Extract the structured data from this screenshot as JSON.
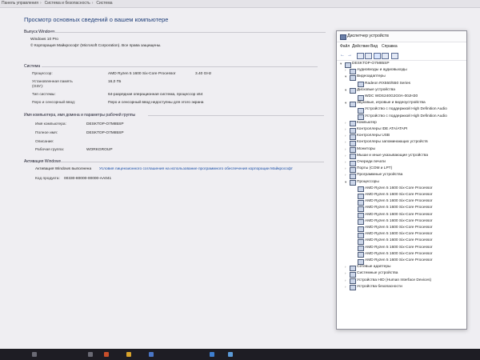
{
  "breadcrumb": {
    "items": [
      "Панель управления",
      "Система и безопасность",
      "Система"
    ]
  },
  "system": {
    "heading": "Просмотр основных сведений о вашем компьютере",
    "edition": {
      "section_title": "Выпуск Windows",
      "name": "Windows 10 Pro",
      "copyright": "© Корпорация Майкрософт (Microsoft Corporation). Все права защищены."
    },
    "specs": {
      "section_title": "Система",
      "rows": [
        {
          "label": "Процессор:",
          "value": "AMD Ryzen 5 1600 Six-Core Processor",
          "extra": "3.40 GHz"
        },
        {
          "label": "Установленная память (ОЗУ):",
          "value": "16,0 ГБ",
          "extra": ""
        },
        {
          "label": "Тип системы:",
          "value": "64-разрядная операционная система, процессор x64",
          "extra": ""
        },
        {
          "label": "Перо и сенсорный ввод:",
          "value": "Перо и сенсорный ввод недоступны для этого экрана",
          "extra": ""
        }
      ]
    },
    "computer": {
      "section_title": "Имя компьютера, имя домена и параметры рабочей группы",
      "rows": [
        {
          "label": "Имя компьютера:",
          "value": "DESKTOP-O7M85SP"
        },
        {
          "label": "Полное имя:",
          "value": "DESKTOP-O7M85SP"
        },
        {
          "label": "Описание:",
          "value": ""
        },
        {
          "label": "Рабочая группа:",
          "value": "WORKGROUP"
        }
      ]
    },
    "activation": {
      "section_title": "Активация Windows",
      "status": "Активация Windows выполнена",
      "link": "Условия лицензионного соглашения на использование программного обеспечения корпорации Майкрософт",
      "product_label": "Код продукта:",
      "product_id": "00330-80000-00000-AA041"
    }
  },
  "device_manager": {
    "title": "Диспетчер устройств",
    "menu": [
      "Файл",
      "Действие",
      "Вид",
      "Справка"
    ],
    "tree": [
      {
        "level": 0,
        "expanded": true,
        "label": "DESKTOP-O7M85SP",
        "icon": "computer-icon"
      },
      {
        "level": 1,
        "expanded": false,
        "label": "Аудиовходы и аудиовыходы",
        "icon": "audio-icon"
      },
      {
        "level": 1,
        "expanded": true,
        "label": "Видеоадаптеры",
        "icon": "display-adapter-icon"
      },
      {
        "level": 2,
        "expanded": null,
        "label": "Radeon RX550/550 Series",
        "icon": "display-adapter-icon"
      },
      {
        "level": 1,
        "expanded": true,
        "label": "Дисковые устройства",
        "icon": "disk-icon"
      },
      {
        "level": 2,
        "expanded": null,
        "label": "WDC WDS240G2G0A-00JH30",
        "icon": "disk-icon"
      },
      {
        "level": 1,
        "expanded": true,
        "label": "Звуковые, игровые и видеоустройства",
        "icon": "sound-icon"
      },
      {
        "level": 2,
        "expanded": null,
        "label": "Устройство с поддержкой High Definition Audio",
        "icon": "sound-icon"
      },
      {
        "level": 2,
        "expanded": null,
        "label": "Устройство с поддержкой High Definition Audio",
        "icon": "sound-icon"
      },
      {
        "level": 1,
        "expanded": false,
        "label": "Компьютер",
        "icon": "computer-icon"
      },
      {
        "level": 1,
        "expanded": false,
        "label": "Контроллеры IDE ATA/ATAPI",
        "icon": "controller-icon"
      },
      {
        "level": 1,
        "expanded": false,
        "label": "Контроллеры USB",
        "icon": "usb-icon"
      },
      {
        "level": 1,
        "expanded": false,
        "label": "Контроллеры запоминающих устройств",
        "icon": "storage-icon"
      },
      {
        "level": 1,
        "expanded": false,
        "label": "Мониторы",
        "icon": "monitor-icon"
      },
      {
        "level": 1,
        "expanded": false,
        "label": "Мыши и иные указывающие устройства",
        "icon": "mouse-icon"
      },
      {
        "level": 1,
        "expanded": false,
        "label": "Очереди печати",
        "icon": "printer-icon"
      },
      {
        "level": 1,
        "expanded": false,
        "label": "Порты (COM и LPT)",
        "icon": "port-icon"
      },
      {
        "level": 1,
        "expanded": false,
        "label": "Программные устройства",
        "icon": "software-device-icon"
      },
      {
        "level": 1,
        "expanded": true,
        "label": "Процессоры",
        "icon": "processor-icon"
      },
      {
        "level": 2,
        "expanded": null,
        "label": "AMD Ryzen 5 1600 Six-Core Processor",
        "icon": "processor-icon"
      },
      {
        "level": 2,
        "expanded": null,
        "label": "AMD Ryzen 5 1600 Six-Core Processor",
        "icon": "processor-icon"
      },
      {
        "level": 2,
        "expanded": null,
        "label": "AMD Ryzen 5 1600 Six-Core Processor",
        "icon": "processor-icon"
      },
      {
        "level": 2,
        "expanded": null,
        "label": "AMD Ryzen 5 1600 Six-Core Processor",
        "icon": "processor-icon"
      },
      {
        "level": 2,
        "expanded": null,
        "label": "AMD Ryzen 5 1600 Six-Core Processor",
        "icon": "processor-icon"
      },
      {
        "level": 2,
        "expanded": null,
        "label": "AMD Ryzen 5 1600 Six-Core Processor",
        "icon": "processor-icon"
      },
      {
        "level": 2,
        "expanded": null,
        "label": "AMD Ryzen 5 1600 Six-Core Processor",
        "icon": "processor-icon"
      },
      {
        "level": 2,
        "expanded": null,
        "label": "AMD Ryzen 5 1600 Six-Core Processor",
        "icon": "processor-icon"
      },
      {
        "level": 2,
        "expanded": null,
        "label": "AMD Ryzen 5 1600 Six-Core Processor",
        "icon": "processor-icon"
      },
      {
        "level": 2,
        "expanded": null,
        "label": "AMD Ryzen 5 1600 Six-Core Processor",
        "icon": "processor-icon"
      },
      {
        "level": 2,
        "expanded": null,
        "label": "AMD Ryzen 5 1600 Six-Core Processor",
        "icon": "processor-icon"
      },
      {
        "level": 2,
        "expanded": null,
        "label": "AMD Ryzen 5 1600 Six-Core Processor",
        "icon": "processor-icon"
      },
      {
        "level": 1,
        "expanded": false,
        "label": "Сетевые адаптеры",
        "icon": "network-icon"
      },
      {
        "level": 1,
        "expanded": false,
        "label": "Системные устройства",
        "icon": "system-device-icon"
      },
      {
        "level": 1,
        "expanded": false,
        "label": "Устройства HID (Human Interface Devices)",
        "icon": "hid-icon"
      },
      {
        "level": 1,
        "expanded": false,
        "label": "Устройства безопасности",
        "icon": "security-device-icon"
      }
    ]
  }
}
